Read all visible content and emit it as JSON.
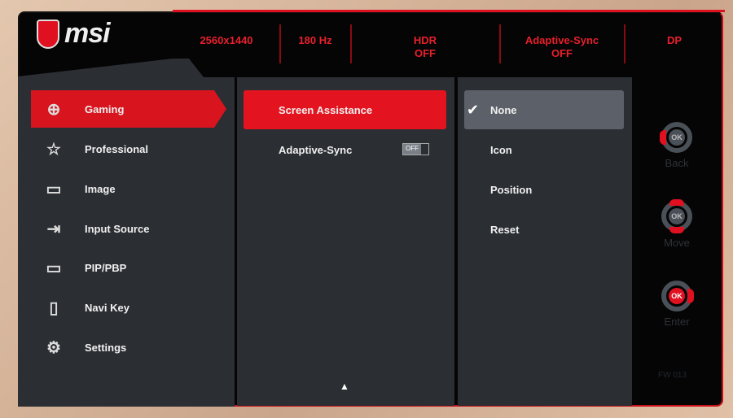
{
  "brand": "msi",
  "status": [
    {
      "label": "2560x1440"
    },
    {
      "label": "180 Hz"
    },
    {
      "label": "HDR",
      "value": "OFF"
    },
    {
      "label": "Adaptive-Sync",
      "value": "OFF"
    },
    {
      "label": "DP"
    }
  ],
  "menu": [
    {
      "label": "Gaming",
      "icon": "gamepad-icon",
      "selected": true
    },
    {
      "label": "Professional",
      "icon": "star-icon"
    },
    {
      "label": "Image",
      "icon": "image-icon"
    },
    {
      "label": "Input Source",
      "icon": "input-icon"
    },
    {
      "label": "PIP/PBP",
      "icon": "pip-icon"
    },
    {
      "label": "Navi Key",
      "icon": "navikey-icon"
    },
    {
      "label": "Settings",
      "icon": "gear-icon"
    }
  ],
  "submenu": [
    {
      "label": "Screen Assistance",
      "selected": true
    },
    {
      "label": "Adaptive-Sync",
      "toggle": "OFF"
    }
  ],
  "options": [
    {
      "label": "None",
      "selected": true
    },
    {
      "label": "Icon"
    },
    {
      "label": "Position"
    },
    {
      "label": "Reset"
    }
  ],
  "keys": {
    "back": "Back",
    "move": "Move",
    "enter": "Enter",
    "ok": "OK"
  },
  "firmware": "FW 013",
  "accent": "#e01020"
}
